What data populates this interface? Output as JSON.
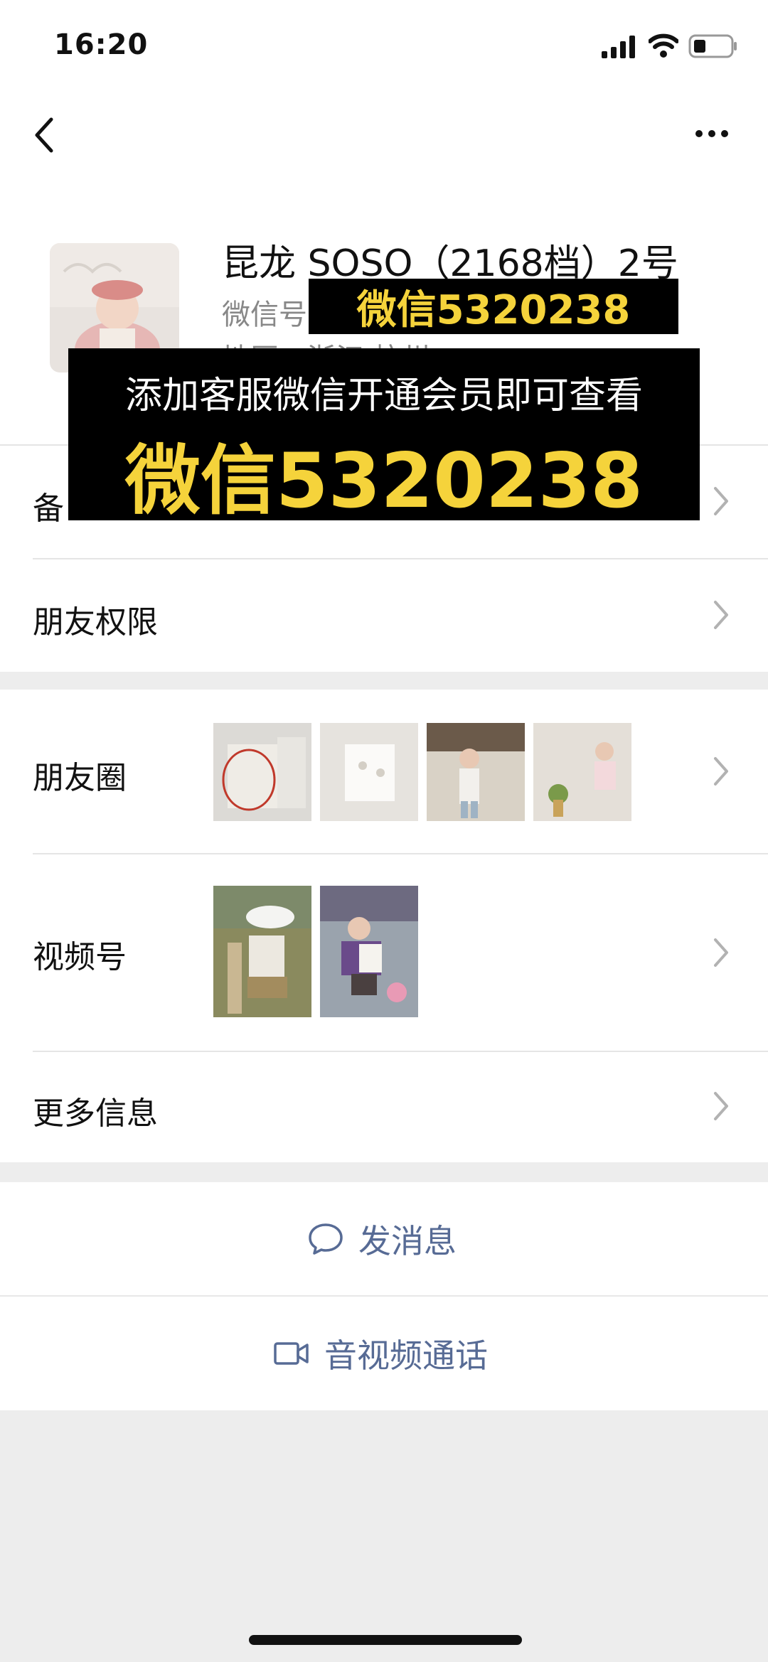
{
  "status_bar": {
    "time": "16:20"
  },
  "profile": {
    "name": "昆龙 SOSO（2168档）2号",
    "wechat_id_label": "微信号",
    "region": "地区：浙江 杭州"
  },
  "rows": {
    "remark": "备",
    "friend_permission": "朋友权限",
    "moments": "朋友圈",
    "channels": "视频号",
    "more_info": "更多信息"
  },
  "actions": {
    "send_message": "发消息",
    "video_call": "音视频通话"
  },
  "overlay": {
    "small_banner": "微信5320238",
    "big_line1": "添加客服微信开通会员即可查看",
    "big_line2": "微信5320238"
  },
  "colors": {
    "link": "#576b95",
    "overlay_yellow": "#f5d33b",
    "background": "#ededed"
  },
  "icons": [
    "back-arrow-icon",
    "more-dots-icon",
    "chevron-right-icon",
    "chat-bubble-icon",
    "video-camera-icon",
    "signal-icon",
    "wifi-icon",
    "battery-icon"
  ]
}
